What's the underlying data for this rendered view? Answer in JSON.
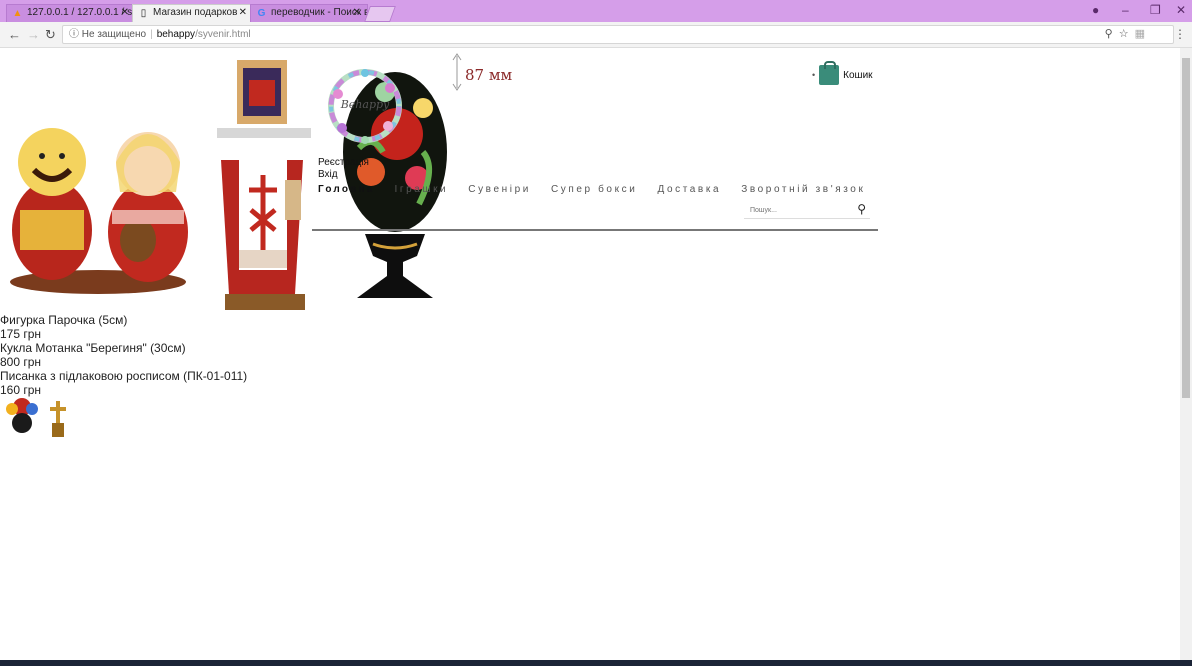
{
  "browser": {
    "tabs": [
      {
        "title": "127.0.0.1 / 127.0.0.1 / sh",
        "active": false,
        "favicon": "phpmyadmin-icon"
      },
      {
        "title": "Магазин подарков",
        "active": true,
        "favicon": "page-icon"
      },
      {
        "title": "переводчик - Поиск в G",
        "active": false,
        "favicon": "google-icon"
      }
    ],
    "tab_close": "✕",
    "address": {
      "security": "Не защищено",
      "host": "behappy",
      "path": "/syvenir.html"
    }
  },
  "header": {
    "logo_text": "Behappy",
    "cart_label": "Кошик",
    "auth": {
      "register": "Реєстрація",
      "login": "Вхід"
    },
    "nav": [
      "Головна",
      "Іграшки",
      "Сувеніри",
      "Супер бокси",
      "Доставка",
      "Зворотній зв'язок"
    ],
    "search_placeholder": "Пошук..."
  },
  "products": [
    {
      "name": "Фигурка Парочка (5см)",
      "price": "175 грн"
    },
    {
      "name": "Кукла Мотанка \"Берегиня\" (30см)",
      "price": "800 грн"
    },
    {
      "name": "Писанка з підлаковою росписом (ПК-01-011)",
      "price": "160 грн",
      "badge": "87 мм"
    }
  ],
  "colors": {
    "accent": "#3e9b8d",
    "tabbar": "#d59ee9"
  }
}
